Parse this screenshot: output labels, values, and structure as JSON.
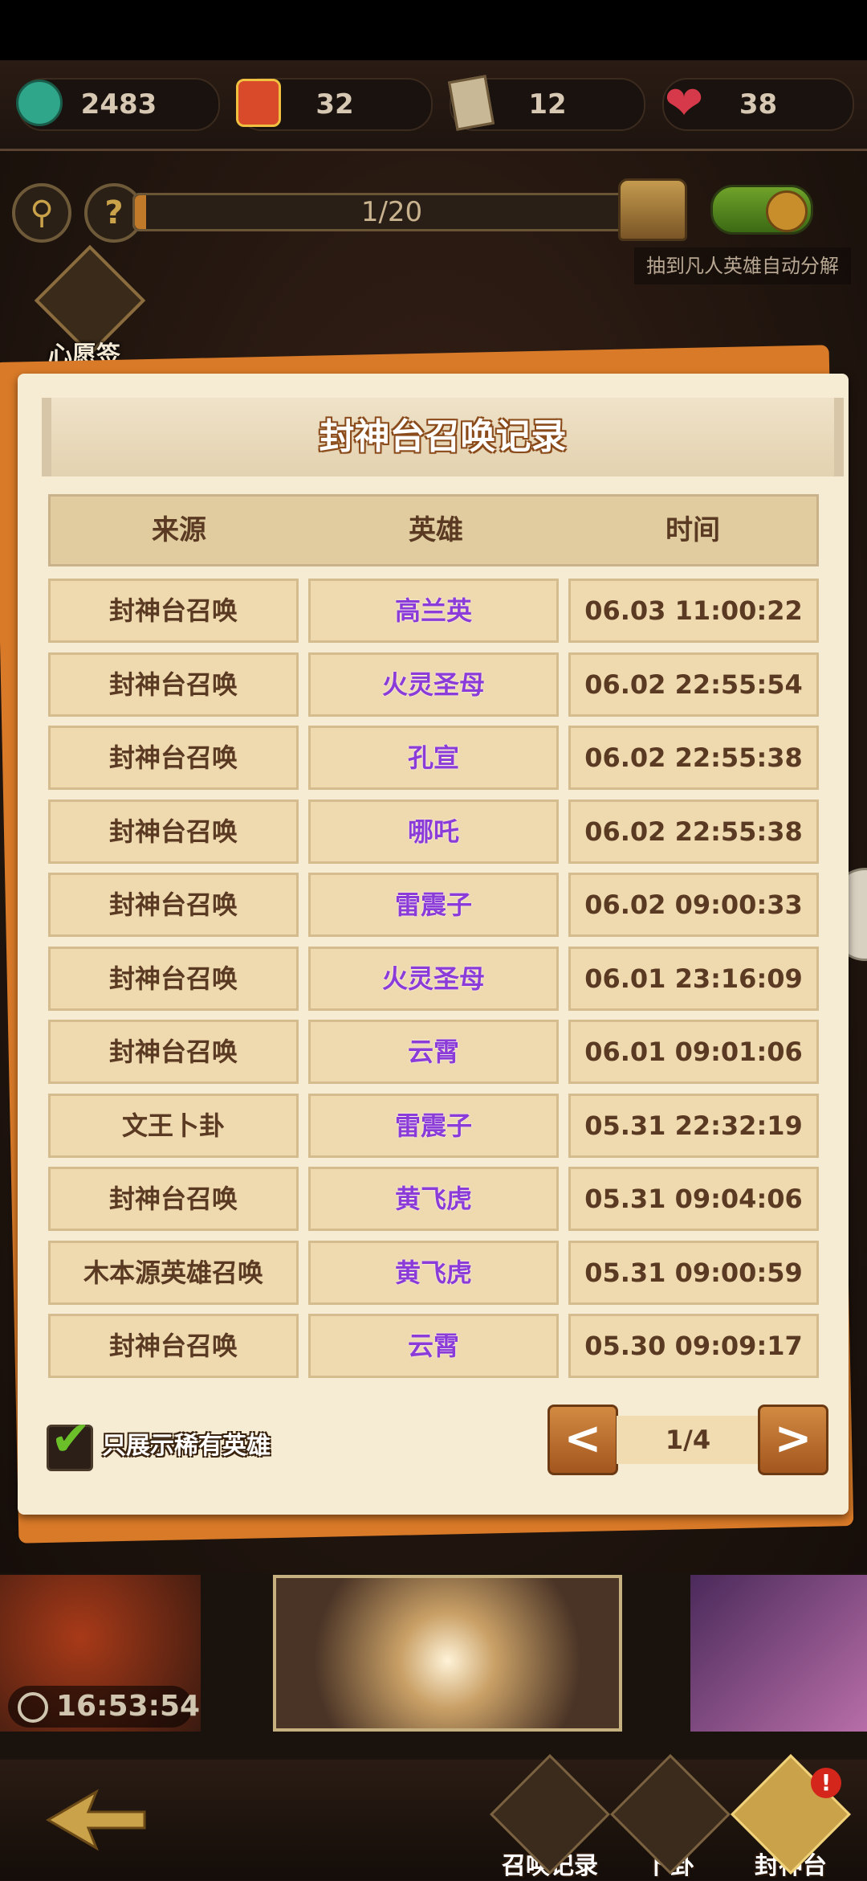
{
  "resources": [
    {
      "icon": "jade-coin-icon",
      "value": "2483"
    },
    {
      "icon": "hero-summon-icon",
      "value": "32"
    },
    {
      "icon": "scroll-ticket-icon",
      "value": "12"
    },
    {
      "icon": "heart-icon",
      "value": "38"
    }
  ],
  "progress": {
    "label": "1/20",
    "fraction": 0.05
  },
  "auto_decompose_label": "抽到凡人英雄自动分解",
  "auto_decompose_on": true,
  "wish_label": "心愿签",
  "modal": {
    "title": "封神台召唤记录",
    "headers": [
      "来源",
      "英雄",
      "时间"
    ],
    "rows": [
      {
        "source": "封神台召唤",
        "hero": "高兰英",
        "time": "06.03 11:00:22"
      },
      {
        "source": "封神台召唤",
        "hero": "火灵圣母",
        "time": "06.02 22:55:54"
      },
      {
        "source": "封神台召唤",
        "hero": "孔宣",
        "time": "06.02 22:55:38"
      },
      {
        "source": "封神台召唤",
        "hero": "哪吒",
        "time": "06.02 22:55:38"
      },
      {
        "source": "封神台召唤",
        "hero": "雷震子",
        "time": "06.02 09:00:33"
      },
      {
        "source": "封神台召唤",
        "hero": "火灵圣母",
        "time": "06.01 23:16:09"
      },
      {
        "source": "封神台召唤",
        "hero": "云霄",
        "time": "06.01 09:01:06"
      },
      {
        "source": "文王卜卦",
        "hero": "雷震子",
        "time": "05.31 22:32:19"
      },
      {
        "source": "封神台召唤",
        "hero": "黄飞虎",
        "time": "05.31 09:04:06"
      },
      {
        "source": "木本源英雄召唤",
        "hero": "黄飞虎",
        "time": "05.31 09:00:59"
      },
      {
        "source": "封神台召唤",
        "hero": "云霄",
        "time": "05.30 09:09:17"
      }
    ],
    "only_rare_label": "只展示稀有英雄",
    "only_rare_checked": true,
    "pager": {
      "prev": "<",
      "page": "1/4",
      "next": ">"
    }
  },
  "timer": "16:53:54",
  "nav": {
    "summon_record": "召唤记录",
    "divination": "卜卦",
    "fengshentai": "封神台",
    "badge": "!"
  },
  "colors": {
    "accent": "#d97a28",
    "hero_purple": "#8b3bd8",
    "modal_bg": "#f6ecd4"
  }
}
